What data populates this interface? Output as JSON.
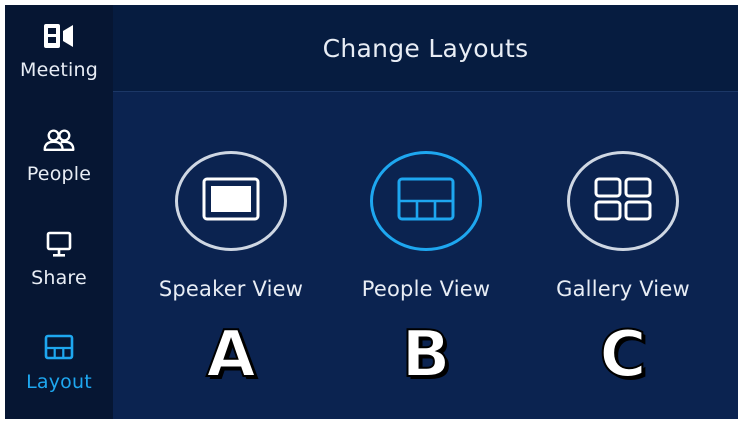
{
  "header": {
    "title": "Change Layouts"
  },
  "sidebar": {
    "items": [
      {
        "label": "Meeting",
        "icon": "meeting-icon",
        "active": false
      },
      {
        "label": "People",
        "icon": "people-icon",
        "active": false
      },
      {
        "label": "Share",
        "icon": "share-icon",
        "active": false
      },
      {
        "label": "Layout",
        "icon": "layout-icon",
        "active": true
      }
    ]
  },
  "layouts": [
    {
      "label": "Speaker View",
      "icon": "speaker-view-icon",
      "selected": false,
      "marker": "A"
    },
    {
      "label": "People View",
      "icon": "people-view-icon",
      "selected": true,
      "marker": "B"
    },
    {
      "label": "Gallery View",
      "icon": "gallery-view-icon",
      "selected": false,
      "marker": "C"
    }
  ],
  "colors": {
    "background": "#0b2350",
    "sidebar": "#061633",
    "accent": "#1ea7f0",
    "text": "#e8edf5"
  }
}
